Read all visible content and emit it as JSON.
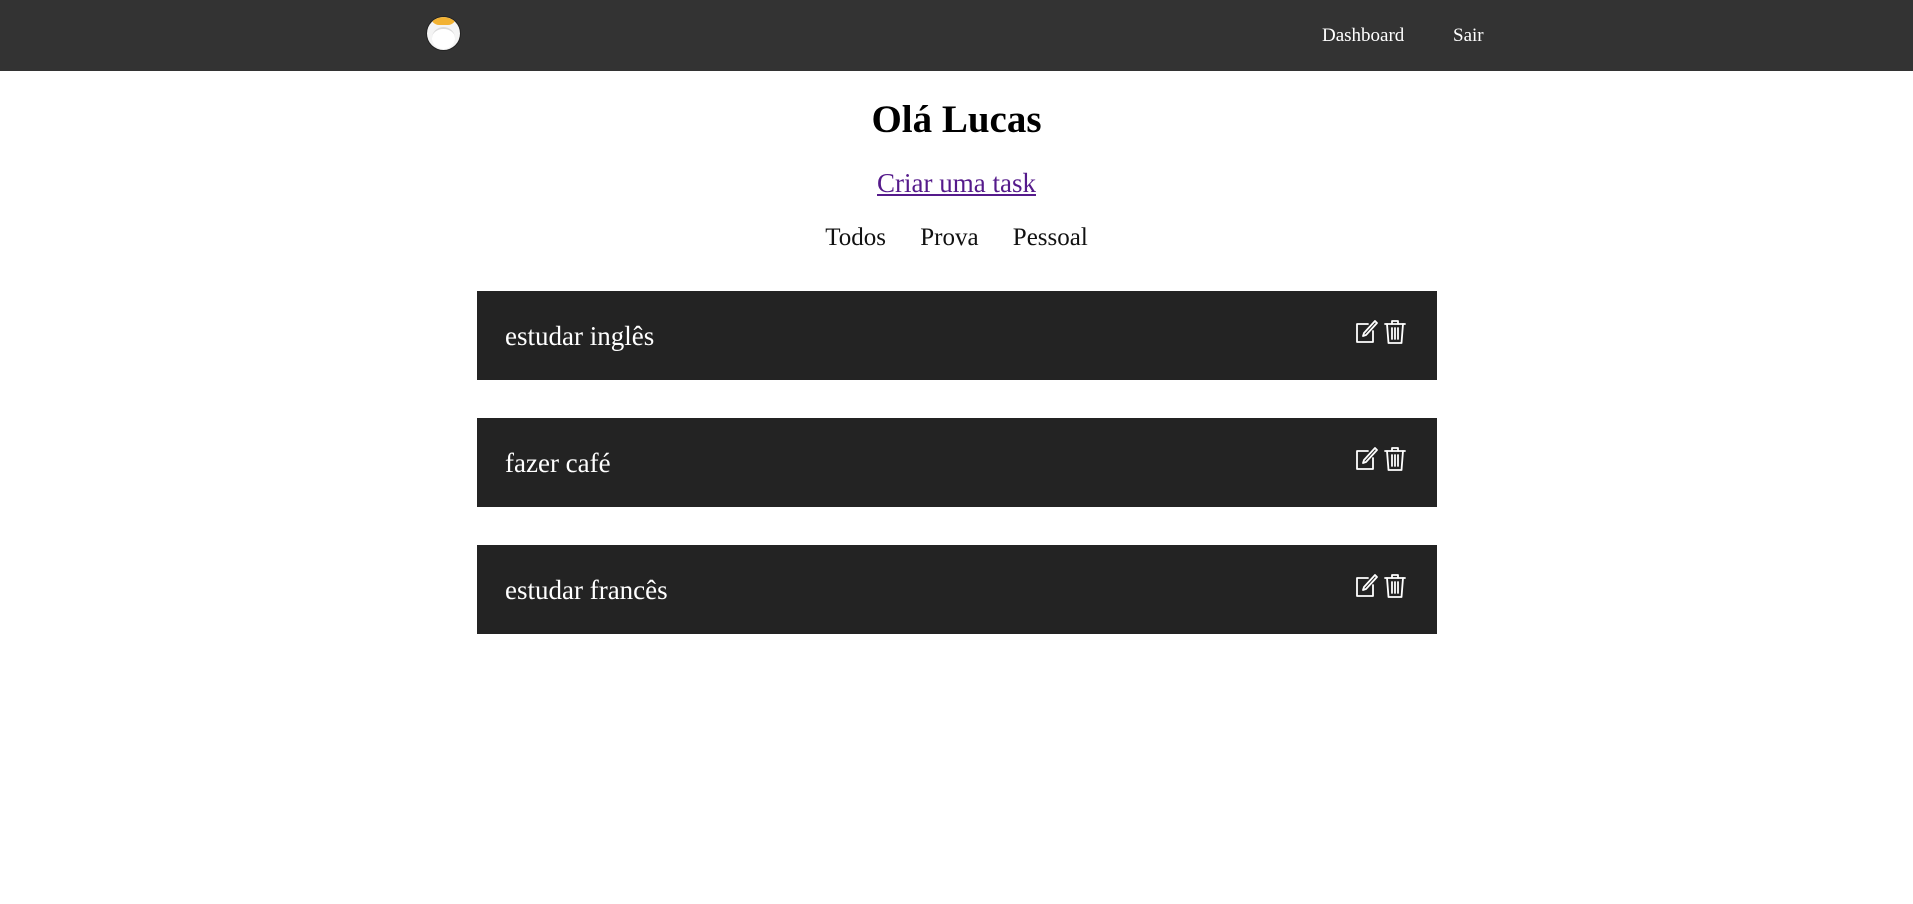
{
  "header": {
    "logo": "logo-icon",
    "nav": {
      "dashboard": "Dashboard",
      "logout": "Sair"
    }
  },
  "main": {
    "greeting": "Olá Lucas",
    "create_link": "Criar uma task",
    "filters": [
      "Todos",
      "Prova",
      "Pessoal"
    ],
    "tasks": [
      {
        "title": "estudar inglês",
        "icons": [
          "edit-icon",
          "trash-icon"
        ]
      },
      {
        "title": "fazer café",
        "icons": [
          "edit-icon",
          "trash-icon"
        ]
      },
      {
        "title": "estudar francês",
        "icons": [
          "edit-icon",
          "trash-icon"
        ]
      }
    ]
  },
  "colors": {
    "navbar": "#333333",
    "task_card": "#232323",
    "link_visited": "#551a8b",
    "logo_accent": "#f2b233"
  }
}
